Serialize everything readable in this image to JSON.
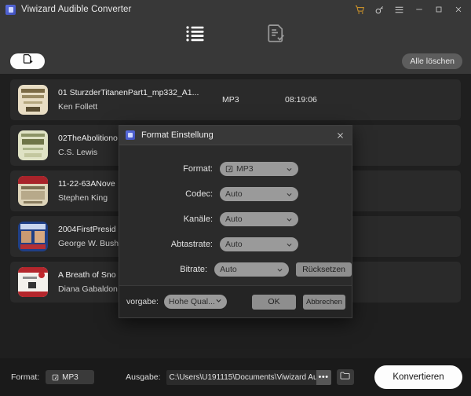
{
  "titlebar": {
    "app_title": "Viwizard Audible Converter",
    "icons": {
      "app": "app-logo-icon",
      "cart": "shopping-cart-icon",
      "key": "key-icon",
      "menu": "hamburger-menu-icon",
      "minimize": "minimize-icon",
      "maximize": "maximize-icon",
      "close": "close-icon"
    },
    "accent_cart_color": "#d99a28"
  },
  "tabs": [
    {
      "name": "library-list-tab",
      "icon": "list-icon",
      "active": true
    },
    {
      "name": "converted-tab",
      "icon": "document-check-icon",
      "active": false
    }
  ],
  "actionbar": {
    "add_file_icon": "add-file-icon",
    "clear_all_label": "Alle löschen"
  },
  "filelist": {
    "rows": [
      {
        "title": "01 SturzderTitanenPart1_mp332_A1...",
        "author": "Ken Follett",
        "format": "MP3",
        "duration": "08:19:06",
        "cover": "cream"
      },
      {
        "title": "02TheAbolitiono",
        "author": "C.S. Lewis",
        "format": "",
        "duration": "",
        "cover": "sage"
      },
      {
        "title": "11-22-63ANove",
        "author": "Stephen King",
        "format": "",
        "duration": "",
        "cover": "red"
      },
      {
        "title": "2004FirstPresid",
        "author": "George W. Bush",
        "format": "",
        "duration": "",
        "cover": "blue"
      },
      {
        "title": "A Breath of Sno",
        "author": "Diana Gabaldon",
        "format": "",
        "duration": "",
        "cover": "white"
      }
    ]
  },
  "dialog": {
    "title": "Format Einstellung",
    "close_icon": "close-icon",
    "fields": [
      {
        "label": "Format:",
        "value": "MP3",
        "has_icon": true
      },
      {
        "label": "Codec:",
        "value": "Auto",
        "has_icon": false
      },
      {
        "label": "Kanäle:",
        "value": "Auto",
        "has_icon": false
      },
      {
        "label": "Abtastrate:",
        "value": "Auto",
        "has_icon": false
      },
      {
        "label": "Bitrate:",
        "value": "Auto",
        "has_icon": false
      }
    ],
    "reset_label": "Rücksetzen",
    "footer": {
      "preset_label": "vorgabe:",
      "preset_value": "Hohe Qual...",
      "ok_label": "OK",
      "cancel_label": "Abbrechen"
    }
  },
  "bottombar": {
    "format_label": "Format:",
    "format_value": "MP3",
    "output_label": "Ausgabe:",
    "output_path": "C:\\Users\\U191115\\Documents\\Viwizard Au",
    "browse_dots": "•••",
    "folder_icon": "folder-icon",
    "convert_label": "Konvertieren"
  }
}
